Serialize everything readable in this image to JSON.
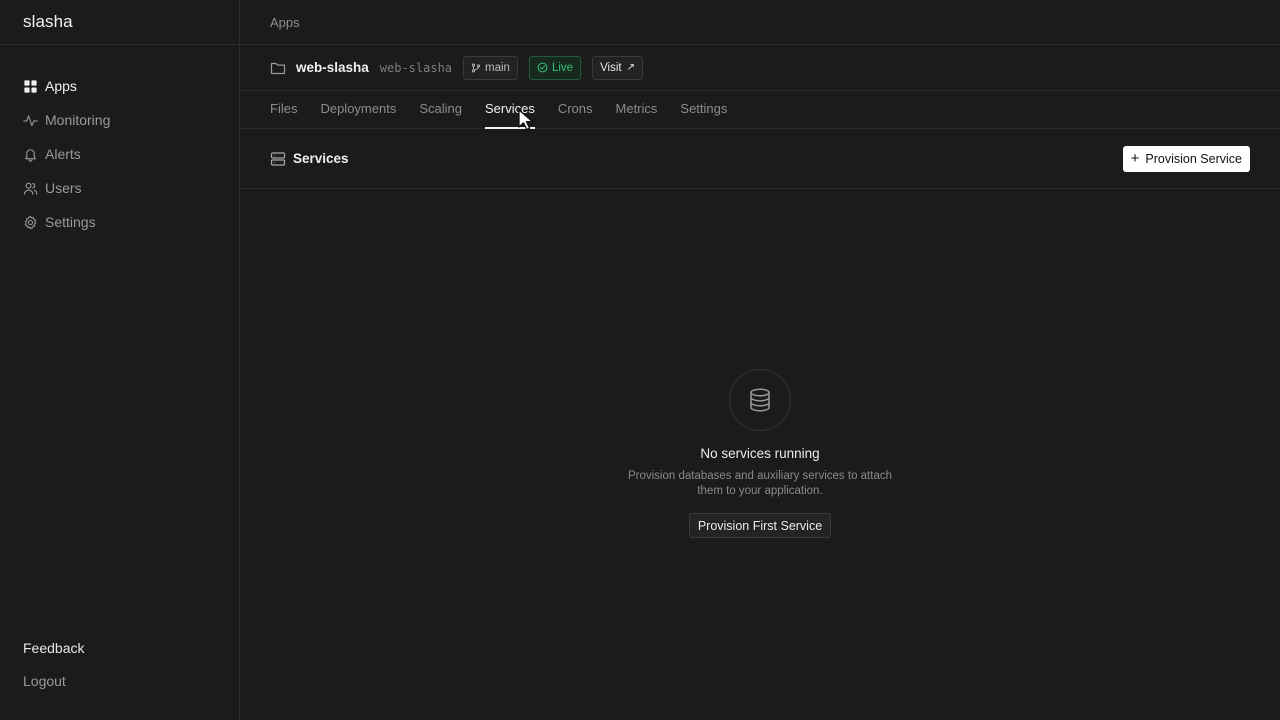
{
  "brand": "slasha",
  "sidebar": {
    "items": [
      {
        "label": "Apps",
        "icon": "grid-icon"
      },
      {
        "label": "Monitoring",
        "icon": "activity-icon"
      },
      {
        "label": "Alerts",
        "icon": "bell-icon"
      },
      {
        "label": "Users",
        "icon": "users-icon"
      },
      {
        "label": "Settings",
        "icon": "gear-icon"
      }
    ],
    "bottom": {
      "feedback": "Feedback",
      "logout": "Logout"
    }
  },
  "breadcrumb": "Apps",
  "app": {
    "name": "web-slasha",
    "slug": "web-slasha",
    "branch": "main",
    "status": "Live",
    "visit": "Visit",
    "status_color": "#37c27a"
  },
  "tabs": [
    "Files",
    "Deployments",
    "Scaling",
    "Services",
    "Crons",
    "Metrics",
    "Settings"
  ],
  "active_tab": "Services",
  "section": {
    "title": "Services",
    "provision_button": "Provision Service"
  },
  "empty_state": {
    "title": "No services running",
    "description": "Provision databases and auxiliary services to attach them to your application.",
    "button": "Provision First Service"
  }
}
